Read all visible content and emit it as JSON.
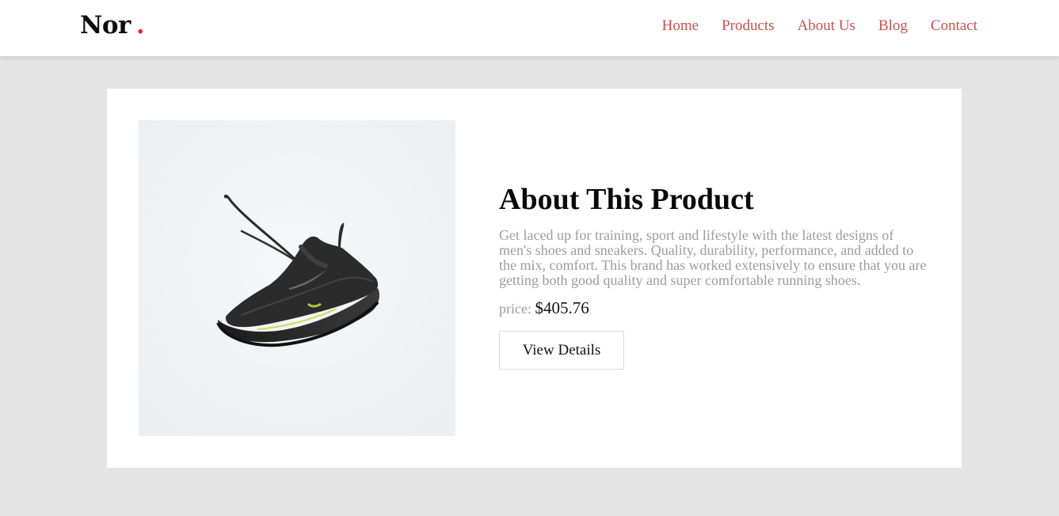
{
  "brand": {
    "name": "Nor",
    "dot": "."
  },
  "nav": {
    "items": [
      "Home",
      "Products",
      "About Us",
      "Blog",
      "Contact"
    ]
  },
  "product": {
    "heading": "About This Product",
    "description": "Get laced up for training, sport and lifestyle with the latest designs of men's shoes and sneakers. Quality, durability, performance, and added to the mix, comfort. This brand has worked extensively to ensure that you are getting both good quality and super comfortable running shoes.",
    "price_label": "price:",
    "price_value": "$405.76",
    "button_label": "View Details",
    "image": "black-running-shoe"
  },
  "colors": {
    "accent": "#e8232f",
    "nav_link": "#c9504f",
    "page_background": "#e4e4e4"
  }
}
